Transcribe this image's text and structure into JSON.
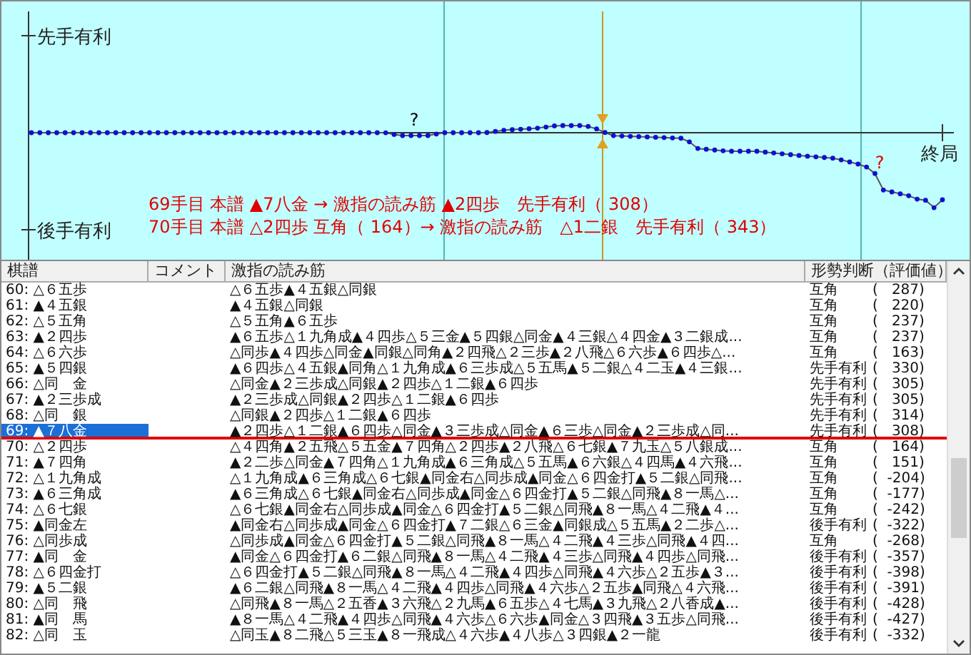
{
  "chart": {
    "top_label": "先手有利",
    "bottom_label": "後手有利",
    "end_label": "終局",
    "marks": [
      {
        "text": "?",
        "color": "#000000"
      },
      {
        "text": "?",
        "color": "#e00000"
      }
    ],
    "info_lines": [
      "69手目 本譜 ▲7八金 → 激指の読み筋 ▲2四歩　先手有利（ 308）",
      "70手目 本譜 △2四歩 互角（ 164）→ 激指の読み筋　△1二銀　先手有利（ 343）"
    ]
  },
  "table": {
    "columns": [
      "棋譜",
      "コメント",
      "激指の読み筋",
      "形勢判断（評価値）"
    ],
    "rows": [
      {
        "move": "60: △６五歩",
        "line": "△６五歩▲４五銀△同銀",
        "judgment": "互角",
        "score": "(   287)",
        "selected": false
      },
      {
        "move": "61: ▲４五銀",
        "line": "▲４五銀△同銀",
        "judgment": "互角",
        "score": "(   220)",
        "selected": false
      },
      {
        "move": "62: △５五角",
        "line": "△５五角▲６五歩",
        "judgment": "互角",
        "score": "(   237)",
        "selected": false
      },
      {
        "move": "63: ▲２四歩",
        "line": "▲６五歩△１九角成▲４四歩△５三金▲５四銀△同金▲４三銀△４四金▲３二銀成...",
        "judgment": "互角",
        "score": "(   237)",
        "selected": false
      },
      {
        "move": "64: △６六歩",
        "line": "△同歩▲４四歩△同金▲同銀△同角▲２四飛△２三歩▲２八飛△６六歩▲６四歩△...",
        "judgment": "互角",
        "score": "(   163)",
        "selected": false
      },
      {
        "move": "65: ▲５四銀",
        "line": "▲６四歩△４五銀▲同角△１九角成▲６三歩成△５五馬▲５二銀△４二玉▲４三銀...",
        "judgment": "先手有利",
        "score": "(   330)",
        "selected": false
      },
      {
        "move": "66: △同　金",
        "line": "△同金▲２三歩成△同銀▲２四歩△１二銀▲６四歩",
        "judgment": "先手有利",
        "score": "(   305)",
        "selected": false
      },
      {
        "move": "67: ▲２三歩成",
        "line": "▲２三歩成△同銀▲２四歩△１二銀▲６四歩",
        "judgment": "先手有利",
        "score": "(   305)",
        "selected": false
      },
      {
        "move": "68: △同　銀",
        "line": "△同銀▲２四歩△１二銀▲６四歩",
        "judgment": "先手有利",
        "score": "(   314)",
        "selected": false
      },
      {
        "move": "69: ▲７八金",
        "line": "▲２四歩△１二銀▲６四歩△同金▲３三歩成△同金▲６三歩△同金▲２三歩成△同...",
        "judgment": "先手有利",
        "score": "(   308)",
        "selected": true
      },
      {
        "move": "70: △２四歩",
        "line": "△４四角▲２五飛△５五金▲７四角△２四歩▲２八飛△６七銀▲７九玉△５八銀成...",
        "judgment": "互角",
        "score": "(   164)",
        "selected": false
      },
      {
        "move": "71: ▲７四角",
        "line": "▲２二歩△同金▲７四角△１九角成▲６三角成△５五馬▲６六銀△４四馬▲４六飛...",
        "judgment": "互角",
        "score": "(   151)",
        "selected": false
      },
      {
        "move": "72: △１九角成",
        "line": "△１九角成▲６三角成△６七銀▲同金右△同歩成▲同金△６四金打▲５二銀△同飛...",
        "judgment": "互角",
        "score": "(  -204)",
        "selected": false
      },
      {
        "move": "73: ▲６三角成",
        "line": "▲６三角成△６七銀▲同金右△同歩成▲同金△６四金打▲５二銀△同飛▲８一馬△...",
        "judgment": "互角",
        "score": "(  -177)",
        "selected": false
      },
      {
        "move": "74: △６七銀",
        "line": "△６七銀▲同金右△同歩成▲同金△６四金打▲５二銀△同飛▲８一馬△４二飛▲４...",
        "judgment": "互角",
        "score": "(  -242)",
        "selected": false
      },
      {
        "move": "75: ▲同金左",
        "line": "▲同金右△同歩成▲同金△６四金打▲７二銀△６三金▲同銀成△５五馬▲２二歩△...",
        "judgment": "後手有利",
        "score": "(  -322)",
        "selected": false
      },
      {
        "move": "76: △同歩成",
        "line": "△同歩成▲同金△６四金打▲５二銀△同飛▲８一馬△４二飛▲４三歩△同飛▲４四...",
        "judgment": "互角",
        "score": "(  -268)",
        "selected": false
      },
      {
        "move": "77: ▲同　金",
        "line": "▲同金△６四金打▲６二銀△同飛▲８一馬△４二飛▲４三歩△同飛▲４四歩△同飛...",
        "judgment": "後手有利",
        "score": "(  -357)",
        "selected": false
      },
      {
        "move": "78: △６四金打",
        "line": "△６四金打▲５二銀△同飛▲８一馬△４二飛▲４四歩△同飛▲４六歩△２五歩▲３...",
        "judgment": "後手有利",
        "score": "(  -398)",
        "selected": false
      },
      {
        "move": "79: ▲５二銀",
        "line": "▲６二銀△同飛▲８一馬△４二飛▲４四歩△同飛▲４六歩△２五歩▲同飛△４六飛...",
        "judgment": "後手有利",
        "score": "(  -391)",
        "selected": false
      },
      {
        "move": "80: △同　飛",
        "line": "△同飛▲８一馬△２五香▲３六飛△２九馬▲６五歩△４七馬▲３九飛△２八香成▲...",
        "judgment": "後手有利",
        "score": "(  -428)",
        "selected": false
      },
      {
        "move": "81: ▲同　馬",
        "line": "▲８一馬△４二飛▲４四歩△同飛▲４六歩△６六歩▲同金△３四飛▲３五歩△同飛...",
        "judgment": "後手有利",
        "score": "(  -427)",
        "selected": false
      },
      {
        "move": "82: △同　玉",
        "line": "△同玉▲８二飛△５三玉▲８一飛成△４六歩▲４八歩△３四銀▲２一龍",
        "judgment": "後手有利",
        "score": "(  -332)",
        "selected": false
      }
    ]
  }
}
